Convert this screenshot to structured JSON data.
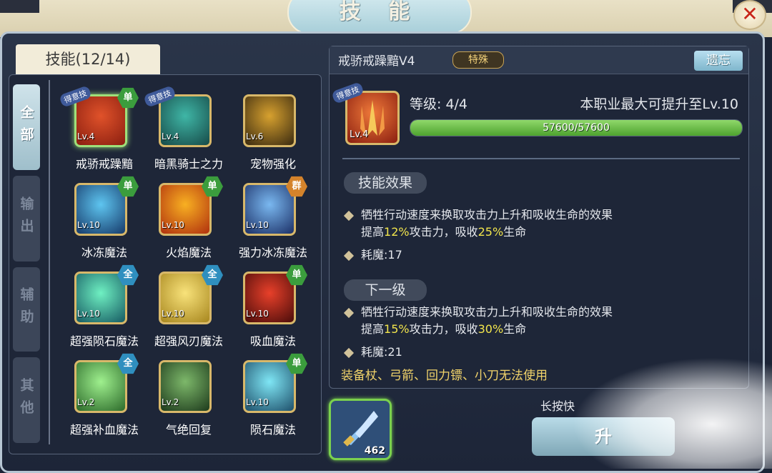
{
  "header": {
    "title": "技 能",
    "close_label": "✕"
  },
  "tab_label": "技能(12/14)",
  "categories": [
    "全部",
    "输出",
    "辅助",
    "其他"
  ],
  "fav_label": "得意技",
  "skills": [
    {
      "name": "戒骄戒躁黯",
      "lv": "Lv.4",
      "badge": "单",
      "badge_color": "#3b9d3d",
      "selected": true,
      "fav": true,
      "colors": [
        "#e0522a",
        "#8a1e10"
      ]
    },
    {
      "name": "暗黑骑士之力",
      "lv": "Lv.4",
      "badge": "",
      "fav": true,
      "colors": [
        "#3fb6a6",
        "#174a48"
      ]
    },
    {
      "name": "宠物强化",
      "lv": "Lv.6",
      "badge": "",
      "colors": [
        "#d7a12f",
        "#3a2a10"
      ]
    },
    {
      "name": "冰冻魔法",
      "lv": "Lv.10",
      "badge": "单",
      "badge_color": "#3b9d3d",
      "colors": [
        "#5ec5f0",
        "#163a6a"
      ]
    },
    {
      "name": "火焰魔法",
      "lv": "Lv.10",
      "badge": "单",
      "badge_color": "#3b9d3d",
      "colors": [
        "#f8b022",
        "#b0300e"
      ]
    },
    {
      "name": "强力冰冻魔法",
      "lv": "Lv.10",
      "badge": "群",
      "badge_color": "#d4832b",
      "colors": [
        "#7ab8f0",
        "#1b2f66"
      ]
    },
    {
      "name": "超强陨石魔法",
      "lv": "Lv.10",
      "badge": "全",
      "badge_color": "#2f8fbf",
      "colors": [
        "#6ff0c2",
        "#165a62"
      ]
    },
    {
      "name": "超强风刃魔法",
      "lv": "Lv.10",
      "badge": "全",
      "badge_color": "#2f8fbf",
      "colors": [
        "#f8e27a",
        "#a7861e"
      ]
    },
    {
      "name": "吸血魔法",
      "lv": "Lv.10",
      "badge": "单",
      "badge_color": "#3b9d3d",
      "colors": [
        "#e8402a",
        "#4a0c0a"
      ]
    },
    {
      "name": "超强补血魔法",
      "lv": "Lv.2",
      "badge": "全",
      "badge_color": "#2f8fbf",
      "colors": [
        "#9ff08e",
        "#2c6a2a"
      ]
    },
    {
      "name": "气绝回复",
      "lv": "Lv.2",
      "badge": "",
      "colors": [
        "#7db86a",
        "#1d3a1c"
      ]
    },
    {
      "name": "陨石魔法",
      "lv": "Lv.10",
      "badge": "单",
      "badge_color": "#3b9d3d",
      "colors": [
        "#7fe6f5",
        "#1e4f6a"
      ]
    }
  ],
  "detail": {
    "title": "戒骄戒躁黯V4",
    "special": "特殊",
    "forget": "遗忘",
    "icon_lv": "Lv.4",
    "level": "等级: 4/4",
    "max": "本职业最大可提升至Lv.10",
    "exp_text": "57600/57600",
    "exp_fraction": 1.0,
    "effect_label": "技能效果",
    "effect_line1": "牺牲行动速度来换取攻击力上升和吸收生命的效果",
    "effect_line2_a": "提高",
    "effect_line2_b": "12%",
    "effect_line2_c": "攻击力，吸收",
    "effect_line2_d": "25%",
    "effect_line2_e": "生命",
    "cost": "耗魔:17",
    "next_label": "下一级",
    "next_line1": "牺牲行动速度来换取攻击力上升和吸收生命的效果",
    "next_line2_a": "提高",
    "next_line2_b": "15%",
    "next_line2_c": "攻击力，吸收",
    "next_line2_d": "30%",
    "next_line2_e": "生命",
    "next_cost": "耗魔:21",
    "warning": "装备杖、弓箭、回力镖、小刀无法使用"
  },
  "item_count": "462",
  "hint": "长按快",
  "upgrade_label": "升"
}
